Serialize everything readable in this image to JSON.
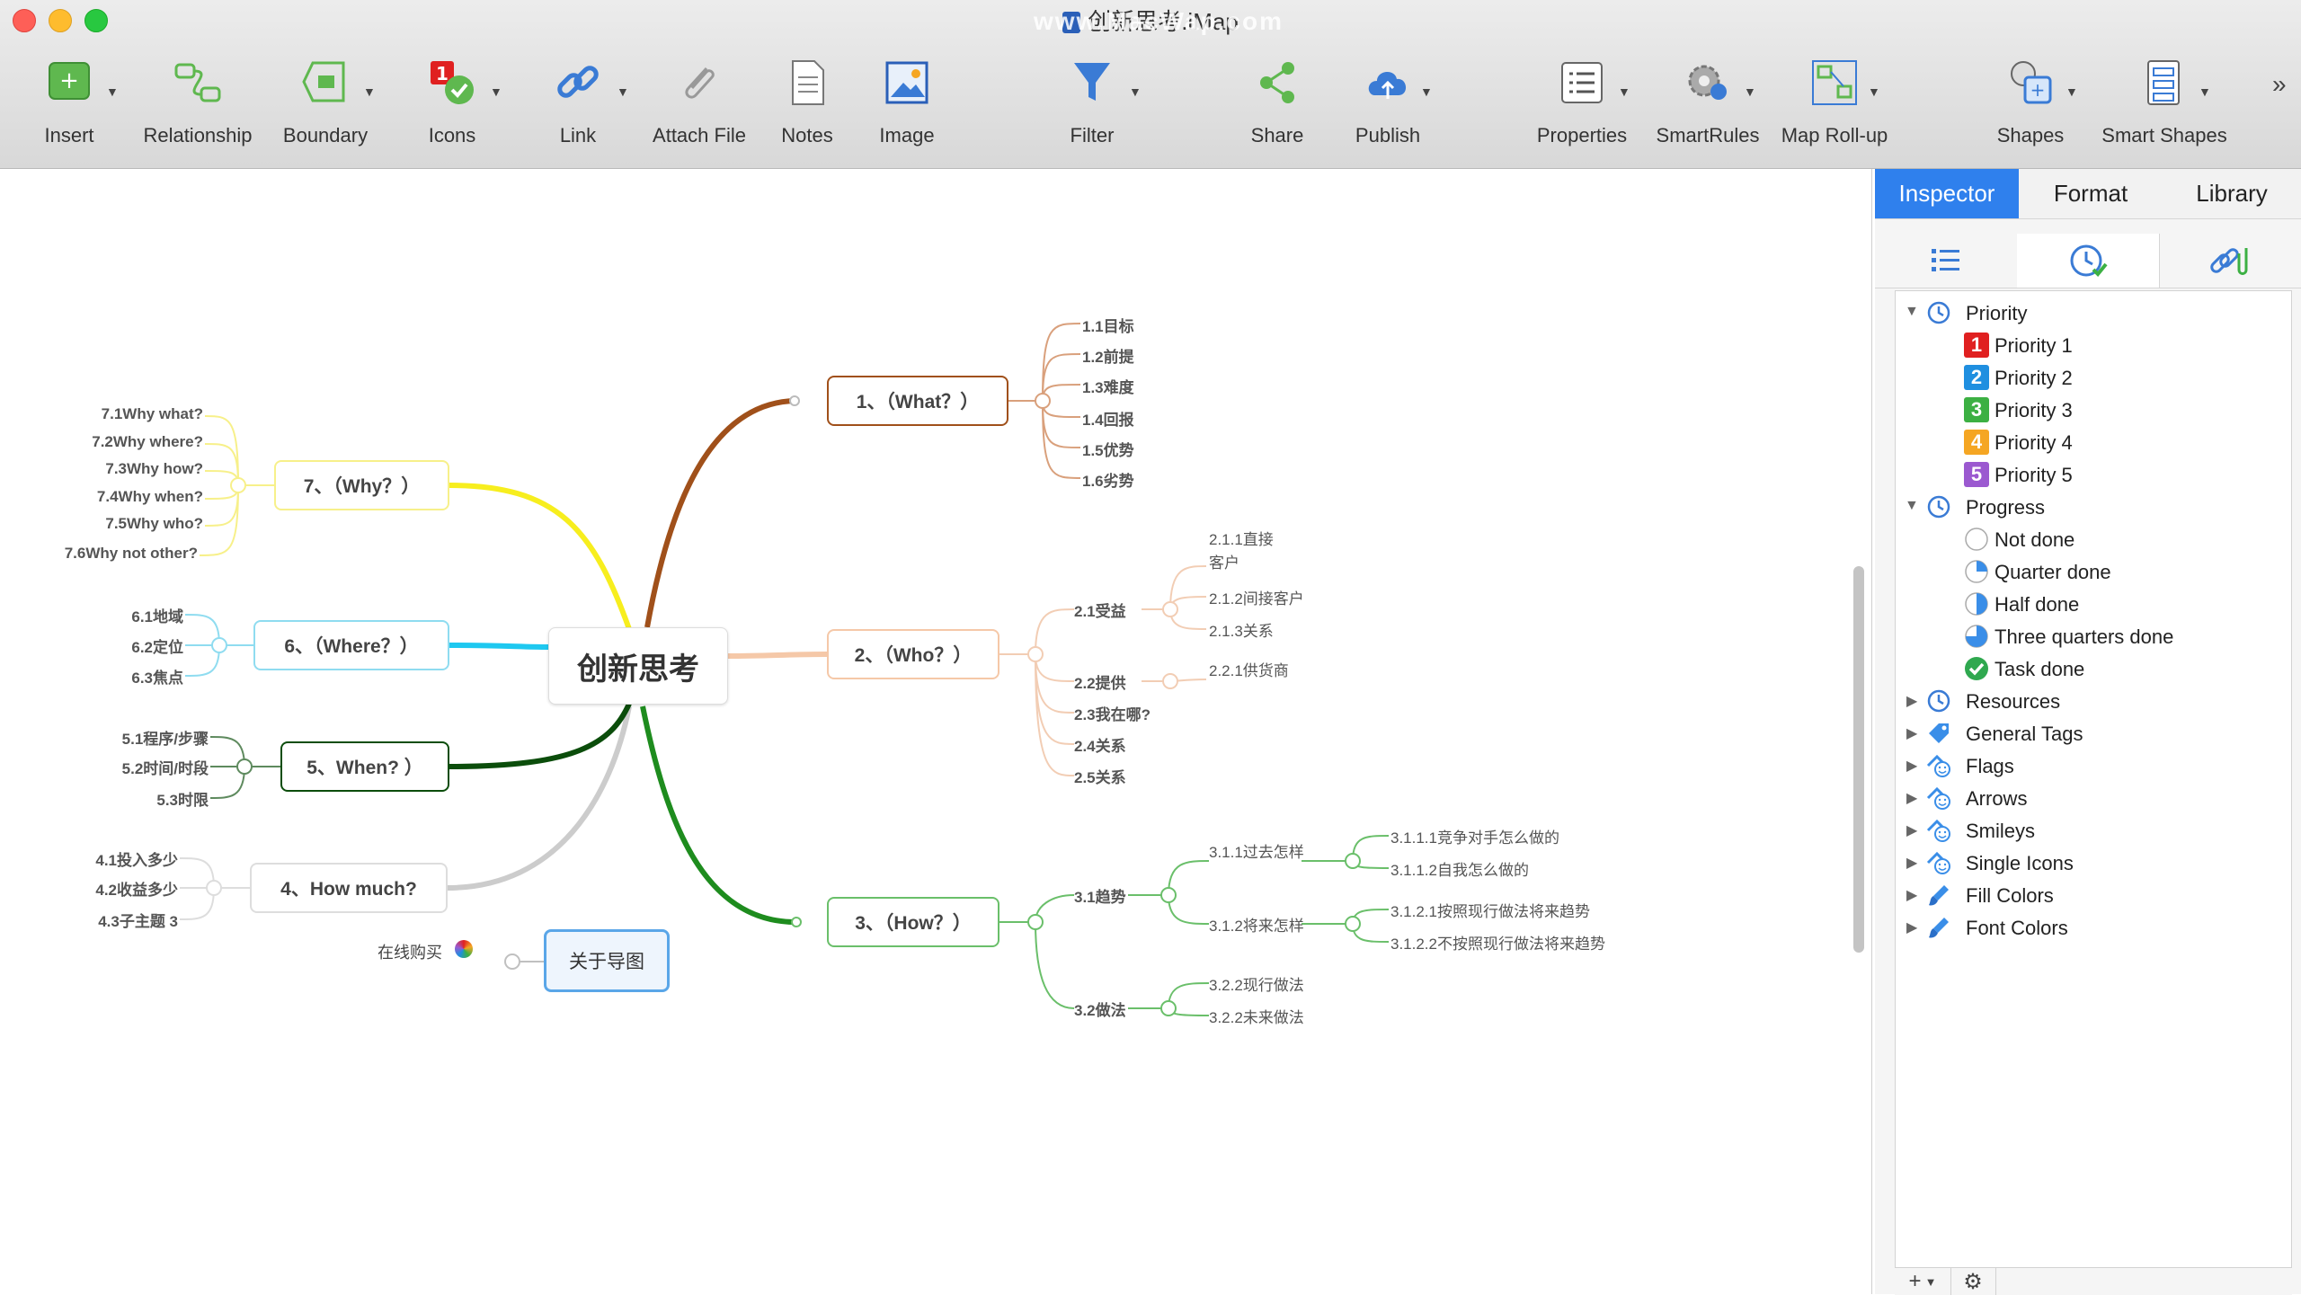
{
  "window": {
    "title": "创新思考.iMap",
    "watermark": "www.MacWap.com"
  },
  "toolbar": {
    "items": [
      {
        "label": "Insert",
        "icon": "insert-topic-icon"
      },
      {
        "label": "Relationship",
        "icon": "relationship-icon"
      },
      {
        "label": "Boundary",
        "icon": "boundary-icon"
      },
      {
        "label": "Icons",
        "icon": "icons-icon"
      },
      {
        "label": "Link",
        "icon": "link-icon"
      },
      {
        "label": "Attach File",
        "icon": "paperclip-icon"
      },
      {
        "label": "Notes",
        "icon": "notes-icon"
      },
      {
        "label": "Image",
        "icon": "image-icon"
      },
      {
        "label": "Filter",
        "icon": "filter-icon"
      },
      {
        "label": "Share",
        "icon": "share-icon"
      },
      {
        "label": "Publish",
        "icon": "cloud-upload-icon"
      },
      {
        "label": "Properties",
        "icon": "properties-icon"
      },
      {
        "label": "SmartRules",
        "icon": "gear-person-icon"
      },
      {
        "label": "Map Roll-up",
        "icon": "map-rollup-icon"
      },
      {
        "label": "Shapes",
        "icon": "shapes-icon"
      },
      {
        "label": "Smart Shapes",
        "icon": "smart-shapes-icon"
      }
    ],
    "overflow": "»"
  },
  "inspector": {
    "tabs": [
      "Inspector",
      "Format",
      "Library"
    ],
    "active_tab": "Inspector",
    "subtabs": [
      "list-icon",
      "clock-check-icon",
      "link-attach-icon"
    ],
    "tree": {
      "priority": {
        "label": "Priority",
        "items": [
          "Priority 1",
          "Priority 2",
          "Priority 3",
          "Priority 4",
          "Priority 5"
        ],
        "colors": [
          "#e02020",
          "#1f8fe0",
          "#3cb043",
          "#f5a623",
          "#9b59d0"
        ],
        "numbers": [
          "1",
          "2",
          "3",
          "4",
          "5"
        ]
      },
      "progress": {
        "label": "Progress",
        "items": [
          "Not done",
          "Quarter done",
          "Half done",
          "Three quarters done",
          "Task done"
        ]
      },
      "collapsed": [
        "Resources",
        "General Tags",
        "Flags",
        "Arrows",
        "Smileys",
        "Single Icons",
        "Fill Colors",
        "Font Colors"
      ]
    },
    "bottom": {
      "add": "+",
      "gear": "⚙"
    }
  },
  "mindmap": {
    "central": "创新思考",
    "about": "关于导图",
    "buy": "在线购买",
    "branches": {
      "b1": {
        "label": "1、（What？）",
        "color": "#a0501a",
        "children": [
          "1.1目标",
          "1.2前提",
          "1.3难度",
          "1.4回报",
          "1.5优势",
          "1.6劣势"
        ]
      },
      "b2": {
        "label": "2、（Who？）",
        "color": "#f5c8a8",
        "children": [
          "2.1受益",
          "2.2提供",
          "2.3我在哪?",
          "2.4关系",
          "2.5关系"
        ],
        "sub": {
          "s211": "2.1.1直接客户",
          "s212": "2.1.2间接客户",
          "s213": "2.1.3关系",
          "s221": "2.2.1供货商"
        }
      },
      "b3": {
        "label": "3、（How？）",
        "color": "#1e8c1e",
        "children": [
          "3.1趋势",
          "3.2做法"
        ],
        "sub": {
          "s311": "3.1.1过去怎样",
          "s312": "3.1.2将来怎样",
          "s3111": "3.1.1.1竞争对手怎么做的",
          "s3112": "3.1.1.2自我怎么做的",
          "s3121": "3.1.2.1按照现行做法将来趋势",
          "s3122": "3.1.2.2不按照现行做法将来趋势",
          "s322": "3.2.2现行做法",
          "s3222": "3.2.2未来做法"
        }
      },
      "b4": {
        "label": "4、How much?",
        "color": "#cccccc",
        "children": [
          "4.1投入多少",
          "4.2收益多少",
          "4.3子主题 3"
        ]
      },
      "b5": {
        "label": "5、When? ）",
        "color": "#0b4d0b",
        "children": [
          "5.1程序/步骤",
          "5.2时间/时段",
          "5.3时限"
        ]
      },
      "b6": {
        "label": "6、（Where？）",
        "color": "#1ec8f0",
        "children": [
          "6.1地域",
          "6.2定位",
          "6.3焦点"
        ]
      },
      "b7": {
        "label": "7、（Why？）",
        "color": "#f7ee1e",
        "children": [
          "7.1Why what?",
          "7.2Why where?",
          "7.3Why how?",
          "7.4Why when?",
          "7.5Why who?",
          "7.6Why not other?"
        ]
      }
    }
  }
}
